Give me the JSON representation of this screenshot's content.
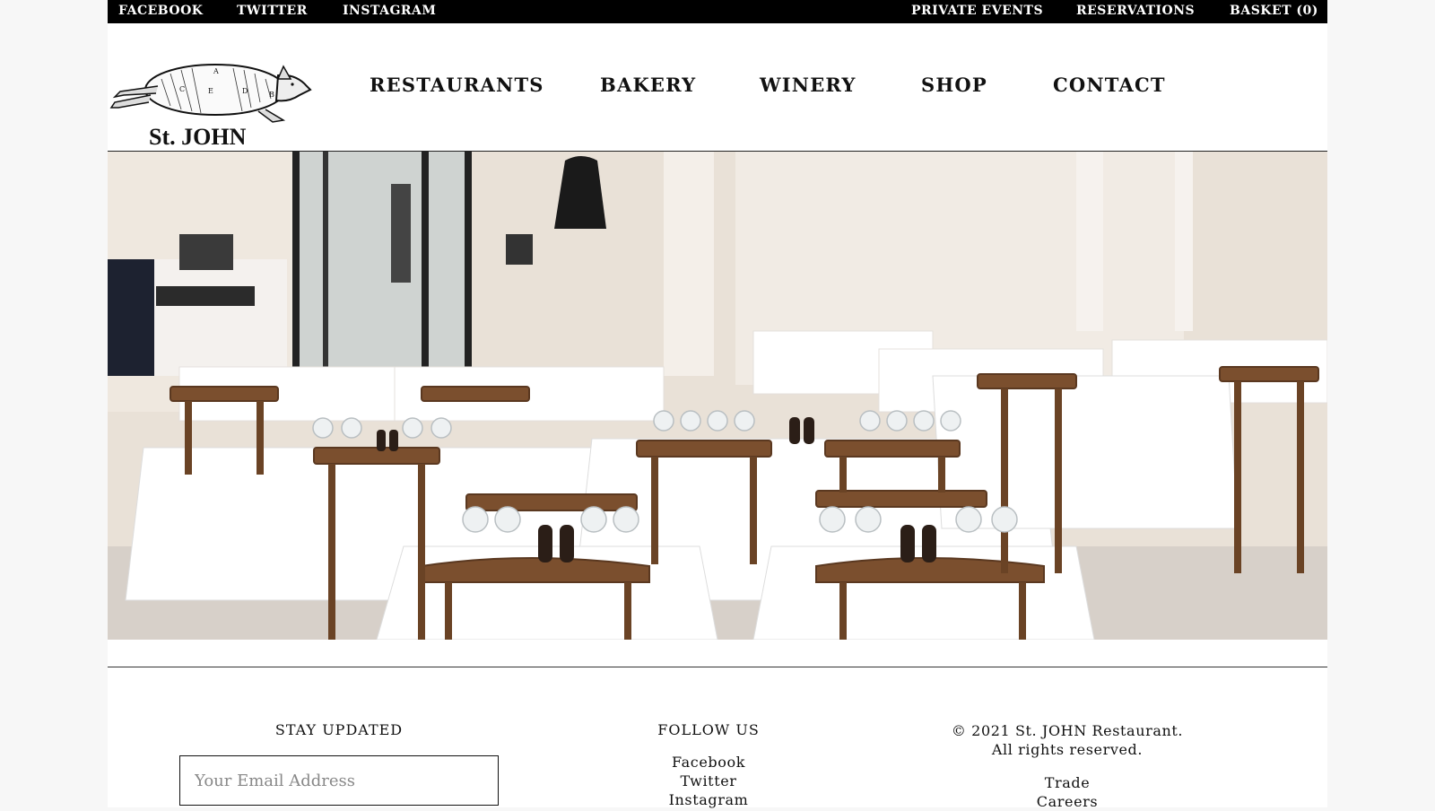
{
  "topbar": {
    "facebook": "FACEBOOK",
    "twitter": "TWITTER",
    "instagram": "INSTAGRAM",
    "private_events": "PRIVATE EVENTS",
    "reservations": "RESERVATIONS",
    "basket": "BASKET (0)"
  },
  "logo": {
    "name": "St. JOHN",
    "icon": "pig-engraving-icon"
  },
  "nav": {
    "items": [
      {
        "label": "RESTAURANTS"
      },
      {
        "label": "BAKERY"
      },
      {
        "label": "WINERY"
      },
      {
        "label": "SHOP"
      },
      {
        "label": "CONTACT"
      }
    ]
  },
  "hero": {
    "icon": "dining-room-photo"
  },
  "footer": {
    "stay_updated": {
      "heading": "STAY UPDATED",
      "email_placeholder": "Your Email Address"
    },
    "follow_us": {
      "heading": "FOLLOW US",
      "links": [
        "Facebook",
        "Twitter",
        "Instagram"
      ]
    },
    "legal": {
      "copyright_line1": "© 2021 St. JOHN Restaurant.",
      "copyright_line2": "All rights reserved.",
      "links": [
        "Trade",
        "Careers"
      ]
    }
  },
  "colors": {
    "topbar_bg": "#000000",
    "page_bg": "#ffffff",
    "text": "#111111"
  }
}
